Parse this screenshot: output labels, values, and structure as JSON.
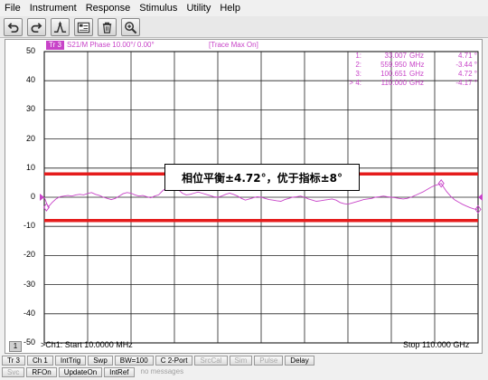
{
  "menu": [
    "File",
    "Instrument",
    "Response",
    "Stimulus",
    "Utility",
    "Help"
  ],
  "toolbar_icons": [
    "undo-icon",
    "redo-icon",
    "marker-peak-icon",
    "save-recall-icon",
    "trash-icon",
    "zoom-icon"
  ],
  "trace": {
    "id": "Tr 3",
    "info": "S21/M Phase 10.00°/ 0.00°",
    "status": "[Trace Max On]",
    "color": "#c844c8"
  },
  "y_ticks": [
    "50",
    "40",
    "30",
    "20",
    "10",
    "0",
    "-10",
    "-20",
    "-30",
    "-40",
    "-50"
  ],
  "markers": [
    {
      "num": "1:",
      "freq": "33.007",
      "unit": "GHz",
      "value": "4.71 °"
    },
    {
      "num": "2:",
      "freq": "559.950",
      "unit": "MHz",
      "value": "-3.44 °"
    },
    {
      "num": "3:",
      "freq": "100.651",
      "unit": "GHz",
      "value": "4.72 °"
    },
    {
      "num": "> 4:",
      "freq": "110.000",
      "unit": "GHz",
      "value": "-4.17 °"
    }
  ],
  "callout": "相位平衡±4.72°，优于指标±8°",
  "channel_number": "1",
  "footer": {
    "start": ">Ch1: Start  10.0000 MHz",
    "stop": "Stop  110.000 GHz"
  },
  "status_row1": [
    {
      "label": "Tr 3",
      "enabled": true
    },
    {
      "label": "Ch 1",
      "enabled": true
    },
    {
      "label": "IntTrig",
      "enabled": true
    },
    {
      "label": "Swp",
      "enabled": true
    },
    {
      "label": "BW=100",
      "enabled": true
    },
    {
      "label": "C  2-Port",
      "enabled": true
    },
    {
      "label": "SrcCal",
      "enabled": false
    },
    {
      "label": "Sim",
      "enabled": false
    },
    {
      "label": "Pulse",
      "enabled": false
    },
    {
      "label": "Delay",
      "enabled": true
    }
  ],
  "status_row2": [
    {
      "label": "Svc",
      "enabled": false
    },
    {
      "label": "RFOn",
      "enabled": true
    },
    {
      "label": "UpdateOn",
      "enabled": true
    },
    {
      "label": "IntRef",
      "enabled": true
    },
    {
      "label": "no messages",
      "enabled": false
    }
  ],
  "chart_data": {
    "type": "line",
    "x_range_ghz": [
      0.01,
      110
    ],
    "ylim": [
      -50,
      50
    ],
    "y_per_div": 10,
    "grid": true,
    "limit_lines": [
      8,
      -8
    ],
    "limit_color": "#e51c1c",
    "trace_color": "#c844c8",
    "series": [
      {
        "x": [
          0.01,
          1,
          2,
          3,
          4,
          5,
          6,
          7,
          8,
          9,
          10,
          11,
          12,
          13,
          14,
          15,
          16,
          17,
          18,
          19,
          20,
          21,
          22,
          23,
          24,
          25,
          26,
          27,
          28,
          29,
          30,
          31,
          32,
          33,
          34,
          35,
          36,
          37,
          38,
          39,
          40,
          41,
          42,
          43,
          44,
          45,
          46,
          47,
          48,
          49,
          50,
          51,
          52,
          53,
          54,
          55,
          56,
          57,
          58,
          59,
          60,
          61,
          62,
          63,
          64,
          65,
          66,
          67,
          68,
          69,
          70,
          71,
          72,
          73,
          74,
          75,
          76,
          77,
          78,
          79,
          80,
          81,
          82,
          83,
          84,
          85,
          86,
          87,
          88,
          89,
          90,
          91,
          92,
          93,
          94,
          95,
          96,
          97,
          98,
          99,
          100,
          100.65,
          101,
          102,
          103,
          104,
          105,
          106,
          107,
          108,
          109,
          110
        ],
        "y": [
          0,
          -3.4,
          -1.8,
          -0.6,
          0.2,
          0.4,
          0.6,
          0.4,
          0.8,
          1.0,
          0.8,
          1.3,
          1.6,
          1.0,
          0.6,
          0.0,
          -0.4,
          -0.8,
          -0.4,
          0.4,
          1.2,
          1.6,
          1.4,
          0.8,
          0.4,
          0.6,
          0.2,
          -0.2,
          0.4,
          0.8,
          2.2,
          3.2,
          4.4,
          4.7,
          2.6,
          1.4,
          0.8,
          1.0,
          1.4,
          1.8,
          1.4,
          1.0,
          0.6,
          0.2,
          0.0,
          0.4,
          1.0,
          1.4,
          1.0,
          0.4,
          -0.4,
          -1.0,
          -0.6,
          -0.2,
          0.2,
          0.0,
          -0.4,
          -0.8,
          -1.0,
          -1.2,
          -1.4,
          -0.8,
          -0.4,
          0.0,
          0.2,
          0.4,
          0.0,
          -0.6,
          -1.0,
          -1.4,
          -1.2,
          -1.0,
          -0.8,
          -0.6,
          -1.0,
          -1.8,
          -2.2,
          -2.4,
          -2.0,
          -1.6,
          -1.2,
          -0.8,
          -0.6,
          -0.4,
          0.0,
          0.2,
          0.4,
          0.2,
          0.0,
          -0.2,
          -0.4,
          -0.6,
          -0.4,
          0.0,
          0.6,
          1.2,
          1.8,
          2.6,
          3.4,
          4.0,
          4.4,
          4.72,
          4.0,
          2.0,
          0.4,
          -0.8,
          -1.6,
          -2.4,
          -3.0,
          -3.6,
          -4.0,
          -4.17
        ]
      }
    ]
  }
}
